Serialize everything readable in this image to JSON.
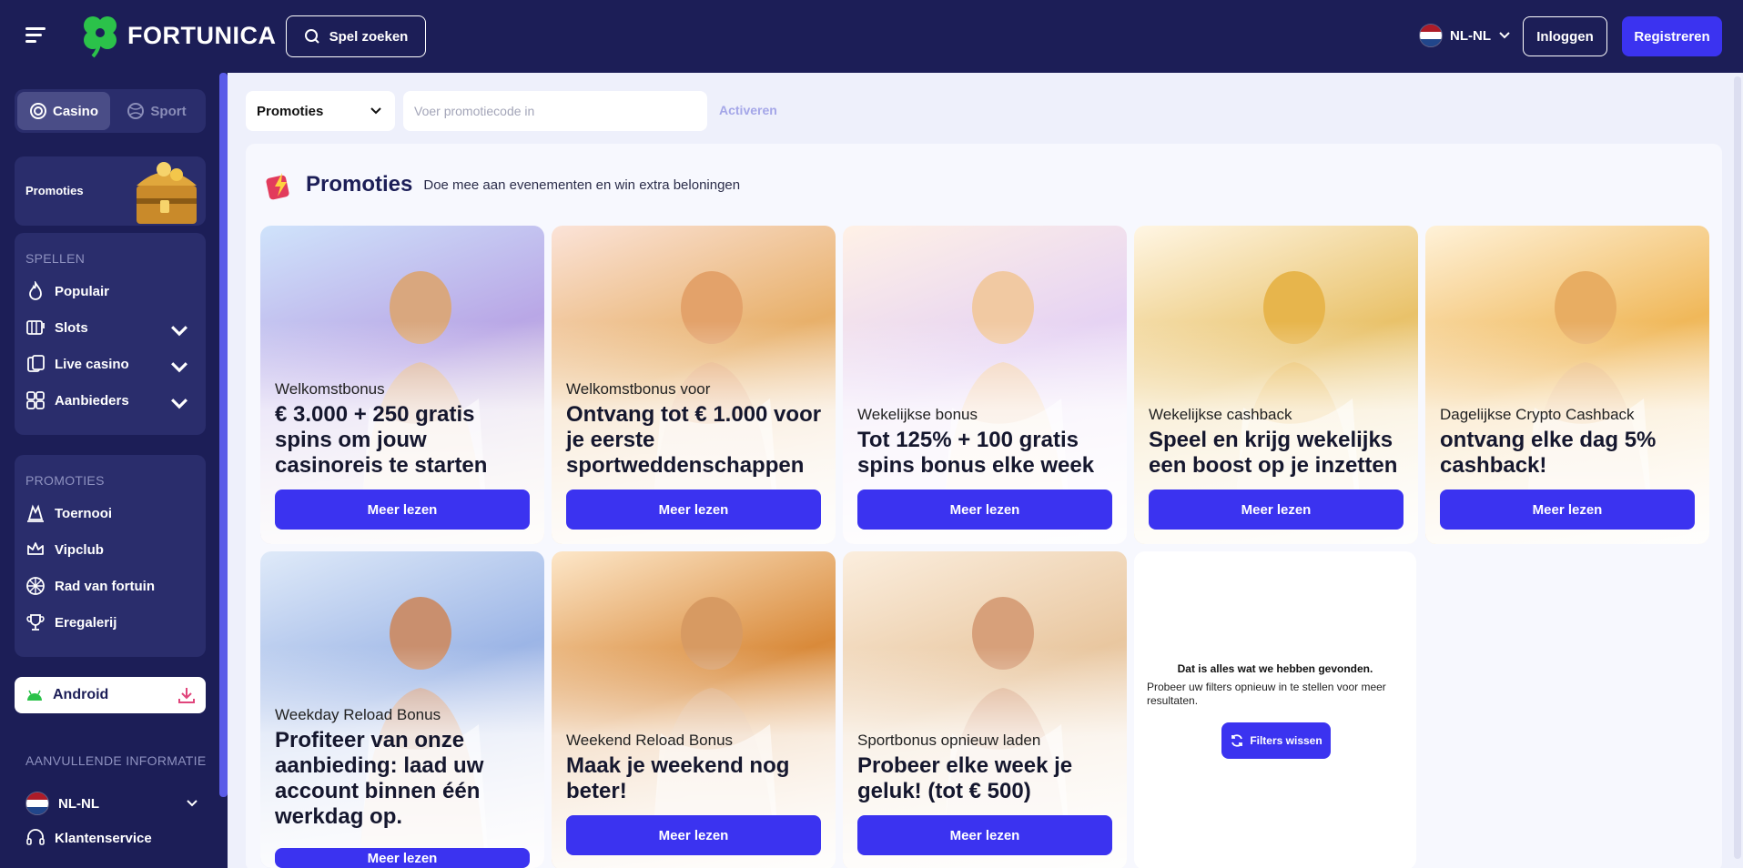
{
  "header": {
    "brand": "FORTUNICA",
    "search_label": "Spel zoeken",
    "language": "NL-NL",
    "login_label": "Inloggen",
    "register_label": "Registreren"
  },
  "sidebar": {
    "mode_casino": "Casino",
    "mode_sport": "Sport",
    "promo_tile": "Promoties",
    "games_heading": "SPELLEN",
    "games": [
      {
        "label": "Populair",
        "icon": "flame-icon"
      },
      {
        "label": "Slots",
        "icon": "slots-icon"
      },
      {
        "label": "Live casino",
        "icon": "cards-icon"
      },
      {
        "label": "Aanbieders",
        "icon": "grid-icon"
      }
    ],
    "promos_heading": "PROMOTIES",
    "promos": [
      {
        "label": "Toernooi",
        "icon": "tournament-icon"
      },
      {
        "label": "Vipclub",
        "icon": "crown-icon"
      },
      {
        "label": "Rad van fortuin",
        "icon": "wheel-icon"
      },
      {
        "label": "Eregalerij",
        "icon": "trophy-icon"
      }
    ],
    "android_label": "Android",
    "extra_heading": "AANVULLENDE INFORMATIE",
    "extra_language": "NL-NL",
    "support_label": "Klantenservice"
  },
  "filters": {
    "category": "Promoties",
    "promo_placeholder": "Voer promotiecode in",
    "activate_label": "Activeren"
  },
  "page": {
    "title": "Promoties",
    "subtitle": "Doe mee aan evenementen en win extra beloningen"
  },
  "cards": [
    {
      "label": "Welkomstbonus",
      "headline": "€ 3.000 + 250 gratis spins om jouw casinoreis te starten",
      "button": "Meer lezen"
    },
    {
      "label": "Welkomstbonus voor",
      "headline": "Ontvang tot € 1.000 voor je eerste sportweddenschappen",
      "button": "Meer lezen"
    },
    {
      "label": "Wekelijkse bonus",
      "headline": "Tot 125% + 100 gratis spins bonus elke week",
      "button": "Meer lezen"
    },
    {
      "label": "Wekelijkse cashback",
      "headline": "Speel en krijg wekelijks een boost op je inzetten",
      "button": "Meer lezen"
    },
    {
      "label": "Dagelijkse Crypto Cashback",
      "headline": "ontvang elke dag 5% cashback!",
      "button": "Meer lezen"
    },
    {
      "label": "Weekday Reload Bonus",
      "headline": "Profiteer van onze aanbieding: laad uw account binnen één werkdag op.",
      "button": "Meer lezen"
    },
    {
      "label": "Weekend Reload Bonus",
      "headline": "Maak je weekend nog beter!",
      "button": "Meer lezen"
    },
    {
      "label": "Sportbonus opnieuw laden",
      "headline": "Probeer elke week je geluk! (tot € 500)",
      "button": "Meer lezen"
    }
  ],
  "empty": {
    "title": "Dat is alles wat we hebben gevonden.",
    "subtitle": "Probeer uw filters opnieuw in te stellen voor meer resultaten.",
    "clear_label": "Filters wissen"
  },
  "colors": {
    "navy": "#1c1e57",
    "accent": "#3b33f0",
    "panel": "#2a2d6c"
  }
}
